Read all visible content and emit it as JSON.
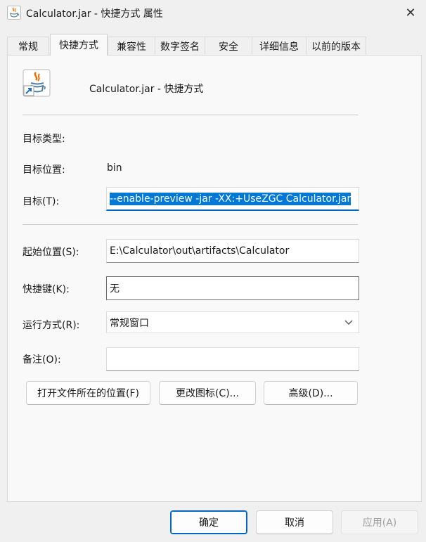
{
  "window": {
    "title": "Calculator.jar - 快捷方式 属性",
    "close_glyph": "✕"
  },
  "tabs": [
    {
      "label": "常规"
    },
    {
      "label": "快捷方式"
    },
    {
      "label": "兼容性"
    },
    {
      "label": "数字签名"
    },
    {
      "label": "安全"
    },
    {
      "label": "详细信息"
    },
    {
      "label": "以前的版本"
    }
  ],
  "shortcut": {
    "name": "Calculator.jar - 快捷方式",
    "icon": "java-icon"
  },
  "fields": {
    "target_type_label": "目标类型:",
    "target_type_value": "",
    "target_location_label": "目标位置:",
    "target_location_value": "bin",
    "target_label": "目标(T):",
    "target_value": "--enable-preview -jar -XX:+UseZGC Calculator.jar",
    "start_in_label": "起始位置(S):",
    "start_in_value": "E:\\Calculator\\out\\artifacts\\Calculator",
    "hotkey_label": "快捷键(K):",
    "hotkey_value": "无",
    "run_label": "运行方式(R):",
    "run_value": "常规窗口",
    "comment_label": "备注(O):",
    "comment_value": ""
  },
  "actions": {
    "open_location": "打开文件所在的位置(F)",
    "change_icon": "更改图标(C)...",
    "advanced": "高级(D)..."
  },
  "footer": {
    "ok": "确定",
    "cancel": "取消",
    "apply": "应用(A)"
  },
  "colors": {
    "accent": "#0078d4"
  }
}
